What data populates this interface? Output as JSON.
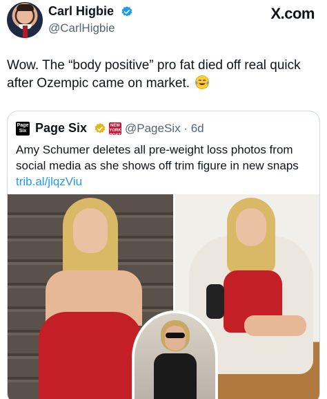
{
  "tweet": {
    "author_name": "Carl Higbie",
    "author_handle": "@CarlHigbie",
    "platform_logo": "X.com",
    "text": "Wow. The “body positive” pro fat died off real quick after Ozempic came on market.",
    "emoji": "face-with-tears-of-joy-icon"
  },
  "quote": {
    "logo_text": "Page Six",
    "name": "Page Six",
    "nyp_badge_text": "NEW YORK POST",
    "handle": "@PageSix",
    "separator": " · ",
    "time": "6d",
    "text": "Amy Schumer deletes all pre-weight loss photos from social media as she shows off trim figure in new snaps ",
    "link": "trib.al/jlqzViu"
  },
  "colors": {
    "verified_blue": "#1d9bf0",
    "verified_gold": "#e2b719",
    "link_blue": "#1d9bf0",
    "dress_red": "#c41f26"
  }
}
